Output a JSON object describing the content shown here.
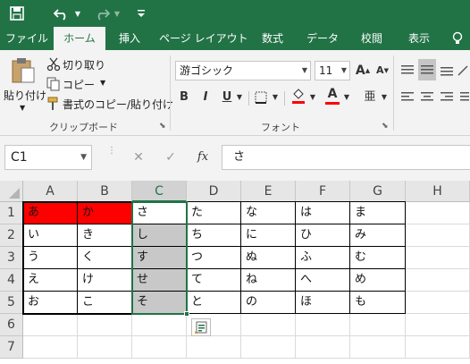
{
  "quick_access": {
    "save_icon": "floppy-disk-icon",
    "undo_icon": "undo-arrow-icon",
    "redo_icon": "redo-arrow-icon",
    "customize_icon": "customize-dropdown-icon"
  },
  "tabs": [
    {
      "label": "ファイル",
      "active": false
    },
    {
      "label": "ホーム",
      "active": true
    },
    {
      "label": "挿入",
      "active": false
    },
    {
      "label": "ページ レイアウト",
      "active": false
    },
    {
      "label": "数式",
      "active": false
    },
    {
      "label": "データ",
      "active": false
    },
    {
      "label": "校閲",
      "active": false
    },
    {
      "label": "表示",
      "active": false
    }
  ],
  "clipboard": {
    "paste_label": "貼り付け",
    "cut_label": "切り取り",
    "copy_label": "コピー",
    "format_painter_label": "書式のコピー/貼り付け",
    "group_label": "クリップボード"
  },
  "font": {
    "font_name": "游ゴシック",
    "font_size": "11",
    "bold": "B",
    "italic": "I",
    "underline": "U",
    "grow": "A",
    "shrink": "A",
    "font_color_letter": "A",
    "phonetic": "亜",
    "group_label": "フォント",
    "fill_color": "#ff0000",
    "font_color": "#ff0000"
  },
  "formula_bar": {
    "name_box": "C1",
    "cancel": "✕",
    "enter": "✓",
    "fx": "fx",
    "content": "さ"
  },
  "grid": {
    "columns": [
      "A",
      "B",
      "C",
      "D",
      "E",
      "F",
      "G",
      "H"
    ],
    "rows": [
      "1",
      "2",
      "3",
      "4",
      "5",
      "6",
      "7"
    ],
    "selected_column": "C",
    "cells": [
      [
        "あ",
        "か",
        "さ",
        "た",
        "な",
        "は",
        "ま",
        ""
      ],
      [
        "い",
        "き",
        "し",
        "ち",
        "に",
        "ひ",
        "み",
        ""
      ],
      [
        "う",
        "く",
        "す",
        "つ",
        "ぬ",
        "ふ",
        "む",
        ""
      ],
      [
        "え",
        "け",
        "せ",
        "て",
        "ね",
        "へ",
        "め",
        ""
      ],
      [
        "お",
        "こ",
        "そ",
        "と",
        "の",
        "ほ",
        "も",
        ""
      ],
      [
        "",
        "",
        "",
        "",
        "",
        "",
        "",
        ""
      ],
      [
        "",
        "",
        "",
        "",
        "",
        "",
        "",
        ""
      ]
    ],
    "red_fill": "#ff0000",
    "gray_fill": "#c8c8c8",
    "selection_color": "#217346"
  },
  "quick_analysis_icon": "quick-analysis-icon"
}
